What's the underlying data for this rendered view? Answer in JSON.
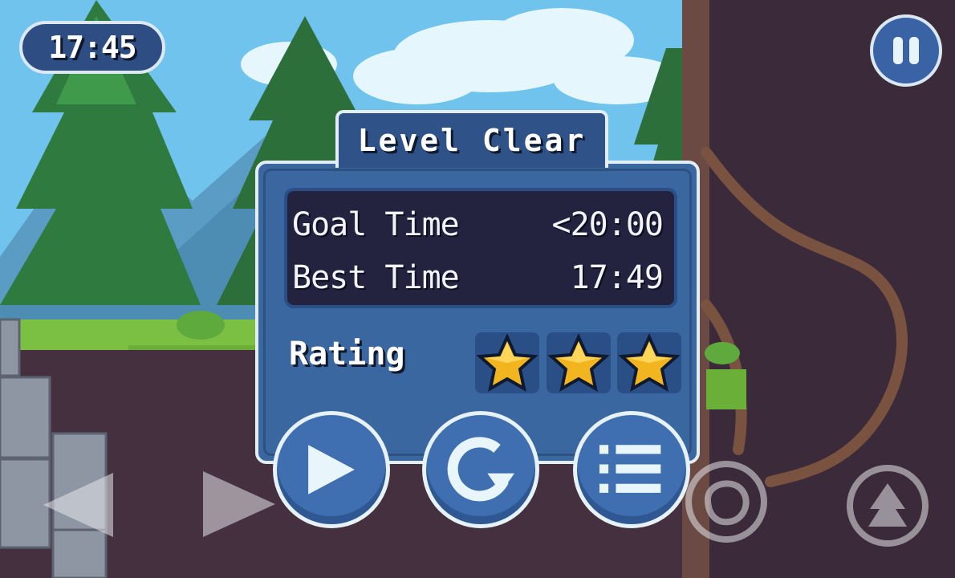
{
  "hud": {
    "timer": "17:45"
  },
  "dialog": {
    "title": "Level Clear",
    "goal_label": "Goal Time",
    "goal_value": "<20:00",
    "best_label": "Best Time",
    "best_value": "17:49",
    "rating_label": "Rating",
    "rating_stars": 3,
    "rating_max": 3,
    "buttons": [
      "play-icon",
      "restart-icon",
      "level-list-icon"
    ]
  },
  "controls": [
    "move-left-icon",
    "move-right-icon",
    "action-icon",
    "jump-icon"
  ],
  "colors": {
    "panel": "#3a67a0",
    "panel_border": "#e2edf4",
    "stats_bg": "#232340",
    "star": "#f2b51f",
    "sky": "#6fc3ec",
    "ground": "#3a2a3a"
  }
}
